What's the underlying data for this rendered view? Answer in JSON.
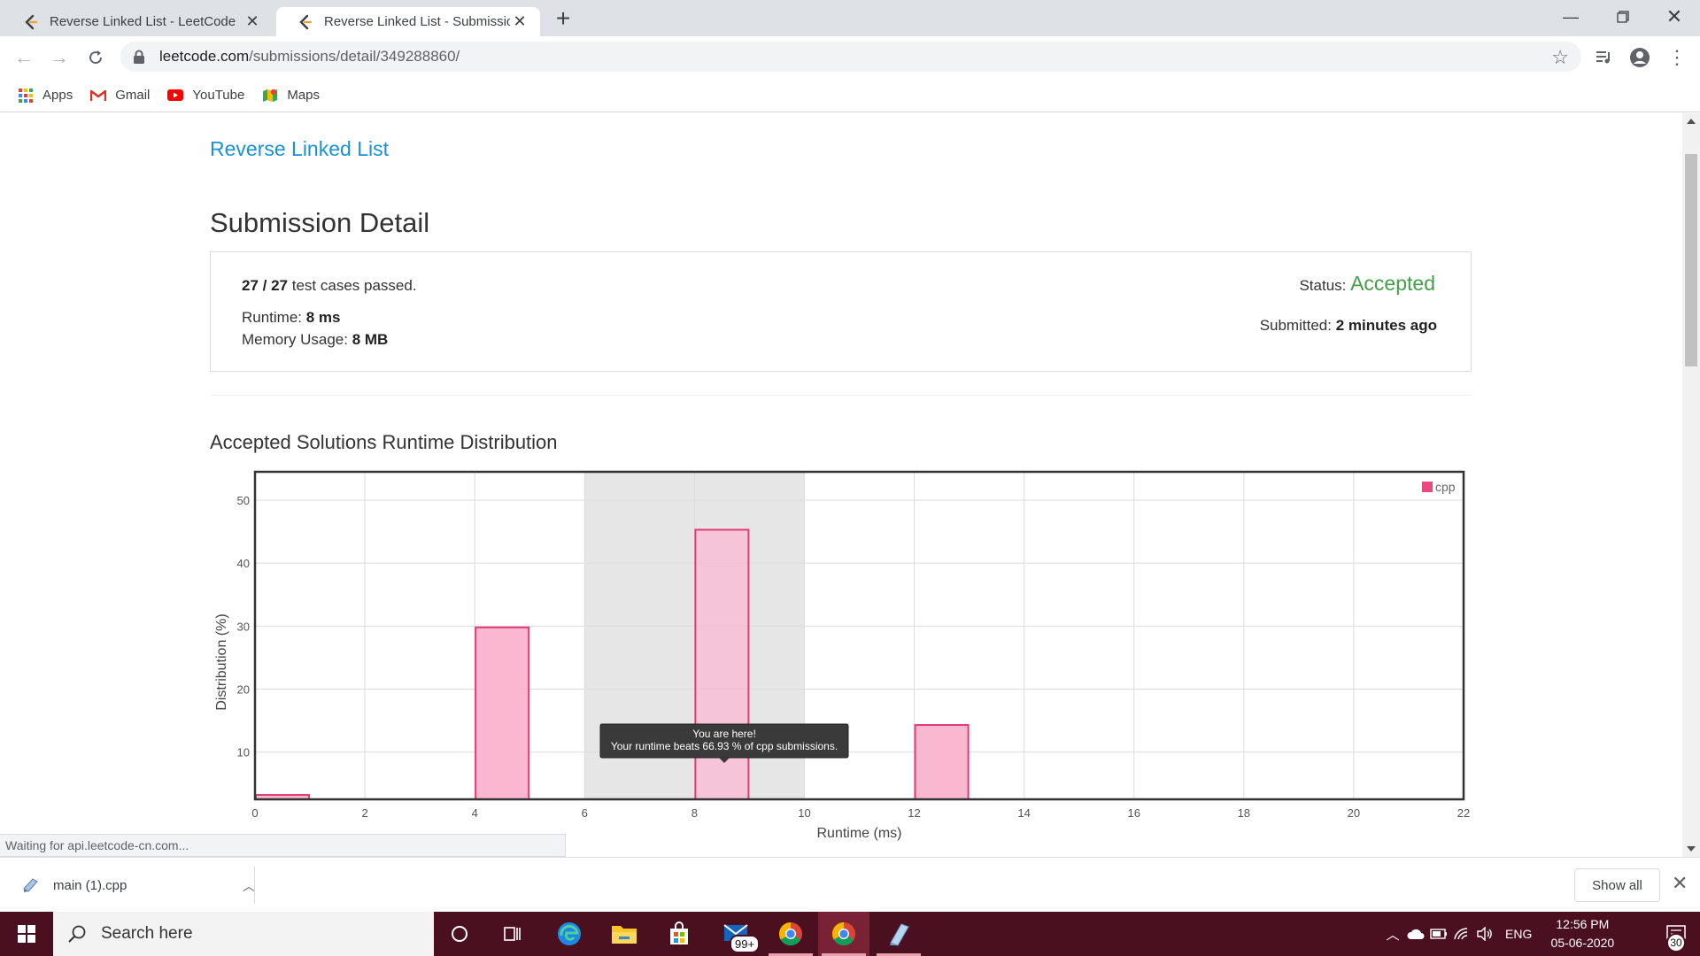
{
  "browser": {
    "tabs": [
      {
        "title": "Reverse Linked List - LeetCode",
        "active": false
      },
      {
        "title": "Reverse Linked List - Submission",
        "active": true
      }
    ],
    "url_host": "leetcode.com",
    "url_path": "/submissions/detail/349288860/",
    "bookmarks": [
      {
        "label": "Apps",
        "icon": "apps-grid-icon"
      },
      {
        "label": "Gmail",
        "icon": "gmail-icon"
      },
      {
        "label": "YouTube",
        "icon": "youtube-icon"
      },
      {
        "label": "Maps",
        "icon": "maps-icon"
      }
    ],
    "status_bubble": "Waiting for api.leetcode-cn.com..."
  },
  "page": {
    "problem_title": "Reverse Linked List",
    "heading": "Submission Detail",
    "tests_passed": "27",
    "tests_separator": " / ",
    "tests_total": "27",
    "tests_suffix": " test cases passed.",
    "runtime_label": "Runtime: ",
    "runtime_value": "8 ms",
    "memory_label": "Memory Usage: ",
    "memory_value": "8 MB",
    "status_label": "Status: ",
    "status_value": "Accepted",
    "submitted_label": "Submitted: ",
    "submitted_value": "2 minutes ago",
    "distribution_heading": "Accepted Solutions Runtime Distribution",
    "colors": {
      "link": "#1a90d9",
      "accepted": "#43a047",
      "bar_fill": "#f9b8d0",
      "bar_stroke": "#e23c73"
    }
  },
  "chart_data": {
    "type": "bar",
    "xlabel": "Runtime (ms)",
    "ylabel": "Distribution (%)",
    "xlim": [
      0,
      22
    ],
    "ylim": [
      2.5,
      54.5
    ],
    "x_ticks": [
      0,
      2,
      4,
      6,
      8,
      10,
      12,
      14,
      16,
      18,
      20,
      22
    ],
    "y_ticks": [
      10,
      20,
      30,
      40,
      50
    ],
    "bar_width": 1,
    "highlight_range": [
      6,
      10
    ],
    "series": [
      {
        "name": "cpp",
        "x": [
          0,
          4,
          8,
          12
        ],
        "values": [
          3.2,
          29.8,
          45.3,
          14.3
        ]
      }
    ],
    "legend_position": "top-right",
    "tooltip": {
      "title": "You are here!",
      "text": "Your runtime beats 66.93 % of cpp submissions."
    }
  },
  "downloads": {
    "file_name": "main (1).cpp",
    "show_all_label": "Show all"
  },
  "taskbar": {
    "search_placeholder": "Search here",
    "mail_badge": "99+",
    "language": "ENG",
    "time": "12:56 PM",
    "date": "05-06-2020",
    "notification_count": "30"
  }
}
